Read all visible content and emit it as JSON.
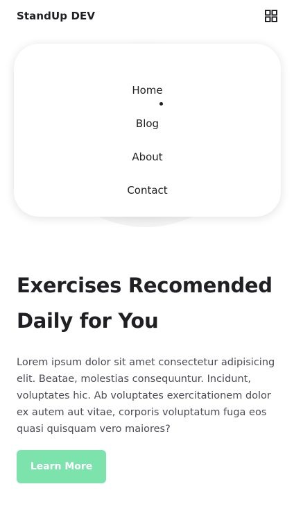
{
  "header": {
    "logo": "StandUp DEV",
    "menu_icon": "grid-menu-icon"
  },
  "nav": {
    "items": [
      {
        "label": "Home",
        "active": true
      },
      {
        "label": "Blog",
        "active": false
      },
      {
        "label": "About",
        "active": false
      },
      {
        "label": "Contact",
        "active": false
      }
    ]
  },
  "hero": {
    "title": "Exercises Recomended Daily for You",
    "description": "Lorem ipsum dolor sit amet consectetur adipisicing elit. Beatae, molestias consequuntur. Incidunt, voluptates hic. Ab voluptates exercitationem dolor ex autem aut vitae, corporis voluptatum fuga eos quasi quisquam vero maiores?",
    "button_label": "Learn More"
  },
  "colors": {
    "accent": "#7ce3ad",
    "text": "#1f1f24",
    "body_text": "#4a4a55"
  }
}
